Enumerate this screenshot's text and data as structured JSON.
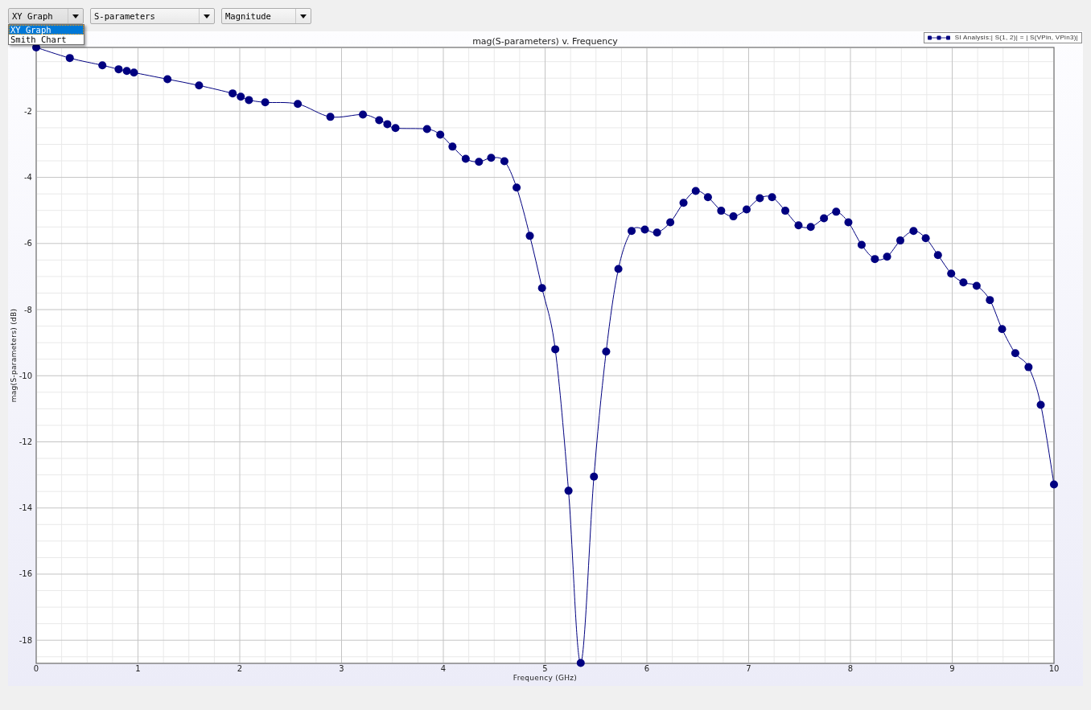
{
  "toolbar": {
    "dropdowns": [
      {
        "value": "XY Graph",
        "options": [
          {
            "label": "XY Graph",
            "selected": true
          },
          {
            "label": "Smith Chart",
            "selected": false
          }
        ]
      },
      {
        "value": "S-parameters"
      },
      {
        "value": "Magnitude"
      }
    ]
  },
  "chart": {
    "chart_data": {
      "type": "line",
      "title": "mag(S-parameters) v. Frequency",
      "xlabel": "Frequency (GHz)",
      "ylabel": "mag(S-parameters) (dB)",
      "grid": true,
      "x": [
        0,
        0.33,
        0.65,
        0.81,
        0.89,
        0.96,
        1.29,
        1.6,
        1.93,
        2.01,
        2.09,
        2.25,
        2.57,
        2.89,
        3.21,
        3.37,
        3.45,
        3.53,
        3.84,
        3.97,
        4.09,
        4.22,
        4.35,
        4.47,
        4.6,
        4.72,
        4.85,
        4.97,
        5.1,
        5.23,
        5.35,
        5.48,
        5.6,
        5.72,
        5.85,
        5.98,
        6.1,
        6.23,
        6.36,
        6.48,
        6.6,
        6.73,
        6.85,
        6.98,
        7.11,
        7.23,
        7.36,
        7.49,
        7.61,
        7.74,
        7.86,
        7.98,
        8.11,
        8.24,
        8.36,
        8.49,
        8.62,
        8.74,
        8.86,
        8.99,
        9.11,
        9.24,
        9.37,
        9.49,
        9.62,
        9.75,
        9.87,
        10
      ],
      "series": [
        {
          "name": "SI Analysis:| S(1, 2)| = | S(VPin, VPin3)|",
          "color": "#000080",
          "marker": "circle",
          "values": [
            -0.07,
            -0.39,
            -0.61,
            -0.73,
            -0.78,
            -0.83,
            -1.03,
            -1.22,
            -1.46,
            -1.56,
            -1.66,
            -1.73,
            -1.78,
            -2.17,
            -2.1,
            -2.27,
            -2.39,
            -2.51,
            -2.54,
            -2.71,
            -3.07,
            -3.44,
            -3.53,
            -3.41,
            -3.51,
            -4.31,
            -5.77,
            -7.35,
            -9.2,
            -13.48,
            -18.69,
            -13.05,
            -9.27,
            -6.77,
            -5.62,
            -5.58,
            -5.67,
            -5.36,
            -4.77,
            -4.41,
            -4.6,
            -5.01,
            -5.18,
            -4.97,
            -4.63,
            -4.6,
            -5.01,
            -5.45,
            -5.5,
            -5.24,
            -5.04,
            -5.36,
            -6.04,
            -6.47,
            -6.4,
            -5.91,
            -5.62,
            -5.84,
            -6.35,
            -6.91,
            -7.18,
            -7.28,
            -7.71,
            -8.59,
            -9.32,
            -9.74,
            -10.88,
            -13.29
          ]
        }
      ],
      "xlim": [
        0,
        10
      ],
      "ylim": [
        -18.7,
        -0.07
      ],
      "xticks": [
        0,
        1,
        2,
        3,
        4,
        5,
        6,
        7,
        8,
        9,
        10
      ],
      "yticks": [
        -18,
        -16,
        -14,
        -12,
        -10,
        -8,
        -6,
        -4,
        -2
      ]
    }
  }
}
